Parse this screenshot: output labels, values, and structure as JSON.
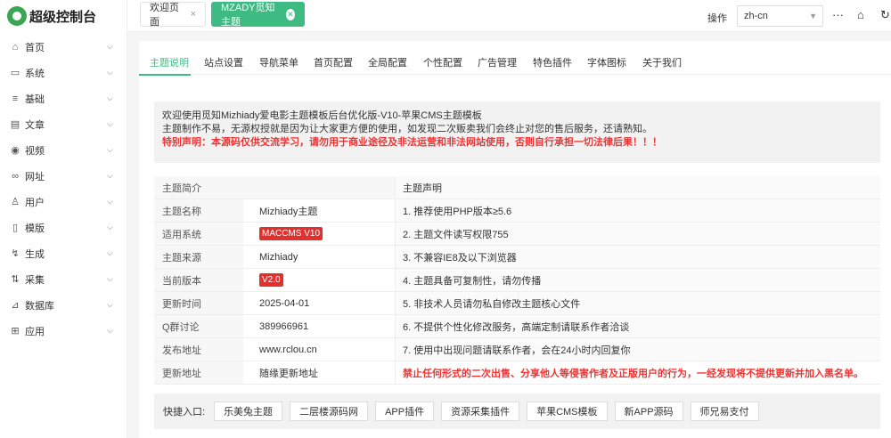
{
  "app": {
    "title": "超级控制台"
  },
  "sidebar": {
    "items": [
      {
        "label": "首页",
        "icon": "home-icon",
        "glyph": "⌂"
      },
      {
        "label": "系统",
        "icon": "monitor-icon",
        "glyph": "▭"
      },
      {
        "label": "基础",
        "icon": "list-icon",
        "glyph": "≡"
      },
      {
        "label": "文章",
        "icon": "document-icon",
        "glyph": "▤"
      },
      {
        "label": "视频",
        "icon": "play-icon",
        "glyph": "◉"
      },
      {
        "label": "网址",
        "icon": "link-icon",
        "glyph": "∞"
      },
      {
        "label": "用户",
        "icon": "user-icon",
        "glyph": "♙"
      },
      {
        "label": "模版",
        "icon": "template-icon",
        "glyph": "▯"
      },
      {
        "label": "生成",
        "icon": "generate-icon",
        "glyph": "↯"
      },
      {
        "label": "采集",
        "icon": "collect-icon",
        "glyph": "⇅"
      },
      {
        "label": "数据库",
        "icon": "database-icon",
        "glyph": "⊿"
      },
      {
        "label": "应用",
        "icon": "apps-icon",
        "glyph": "⊞"
      }
    ]
  },
  "topbar": {
    "tabs": [
      {
        "label": "欢迎页面",
        "close": "×"
      },
      {
        "label": "MZADY觅知主题",
        "close": "✕"
      }
    ],
    "op_label": "操作",
    "language": "zh-cn",
    "more": "···",
    "home": "⌂",
    "refresh": "↻"
  },
  "nav": {
    "tabs": [
      "主题说明",
      "站点设置",
      "导航菜单",
      "首页配置",
      "全局配置",
      "个性配置",
      "广告管理",
      "特色插件",
      "字体图标",
      "关于我们"
    ]
  },
  "notice": {
    "line1": "欢迎使用觅知Mizhiady爱电影主题模板后台优化版-V10-苹果CMS主题模板",
    "line2": "主题制作不易，无源权授就是因为让大家更方便的使用，如发现二次贩卖我们会终止对您的售后服务，还请熟知。",
    "line3": "特别声明：本源码仅供交流学习，请勿用于商业途径及非法运营和非法网站使用，否则自行承担一切法律后果！！！"
  },
  "info": {
    "left_header": "主题简介",
    "right_header": "主题声明",
    "rows": [
      {
        "label": "主题名称",
        "value": "Mizhiady主题",
        "badge": false
      },
      {
        "label": "适用系统",
        "value": "MACCMS V10",
        "badge": true
      },
      {
        "label": "主题来源",
        "value": "Mizhiady",
        "badge": false
      },
      {
        "label": "当前版本",
        "value": "V2.0",
        "badge": true
      },
      {
        "label": "更新时间",
        "value": "2025-04-01",
        "badge": false
      },
      {
        "label": "Q群讨论",
        "value": "389966961",
        "badge": false
      },
      {
        "label": "发布地址",
        "value": "www.rclou.cn",
        "badge": false
      },
      {
        "label": "更新地址",
        "value": "随缘更新地址",
        "badge": false
      }
    ],
    "statements": [
      "1. 推荐使用PHP版本≥5.6",
      "2. 主题文件读写权限755",
      "3. 不兼容IE8及以下浏览器",
      "4. 主题具备可复制性，请勿传播",
      "5. 非技术人员请勿私自修改主题核心文件",
      "6. 不提供个性化修改服务，高端定制请联系作者洽谈",
      "7. 使用中出现问题请联系作者，会在24小时内回复你",
      "禁止任何形式的二次出售、分享他人等侵害作者及正版用户的行为，一经发现将不提供更新并加入黑名单。"
    ]
  },
  "quick": {
    "label": "快捷入口:",
    "buttons": [
      "乐美兔主题",
      "二层楼源码网",
      "APP插件",
      "资源采集插件",
      "苹果CMS模板",
      "新APP源码",
      "师兄易支付"
    ]
  },
  "colors": {
    "accent": "#3dbb83",
    "danger": "#e33333"
  }
}
